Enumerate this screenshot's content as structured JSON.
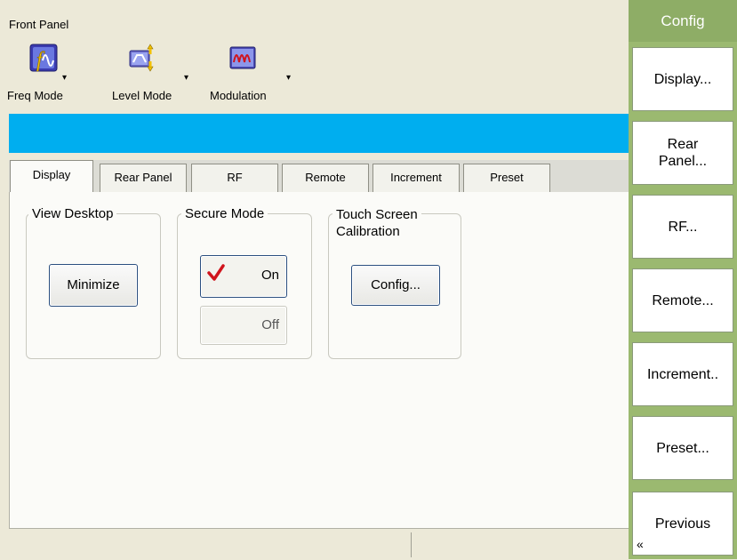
{
  "panel_title": "Front Panel",
  "toolbar": {
    "freq_mode": "Freq Mode",
    "level_mode": "Level Mode",
    "modulation": "Modulation"
  },
  "tabs": [
    "Display",
    "Rear Panel",
    "RF",
    "Remote",
    "Increment",
    "Preset"
  ],
  "active_tab": "Display",
  "groups": {
    "view_desktop": {
      "legend": "View Desktop",
      "minimize": "Minimize"
    },
    "secure_mode": {
      "legend": "Secure Mode",
      "on": "On",
      "off": "Off",
      "selected": "On"
    },
    "touch_screen": {
      "legend_line1": "Touch Screen",
      "legend_line2": "Calibration",
      "config": "Config..."
    }
  },
  "softkeys": {
    "title": "Config",
    "display": "Display...",
    "rear_panel_1": "Rear",
    "rear_panel_2": "Panel...",
    "rf": "RF...",
    "remote": "Remote...",
    "increment": "Increment..",
    "preset": "Preset...",
    "previous": "Previous",
    "previous_chevron": "«"
  },
  "colors": {
    "accent_blue": "#00aeef",
    "softkey_green": "#9bb970",
    "check_red": "#d0141c"
  },
  "icons": [
    "freq-mode-icon",
    "level-mode-icon",
    "modulation-icon",
    "checkmark-icon"
  ]
}
